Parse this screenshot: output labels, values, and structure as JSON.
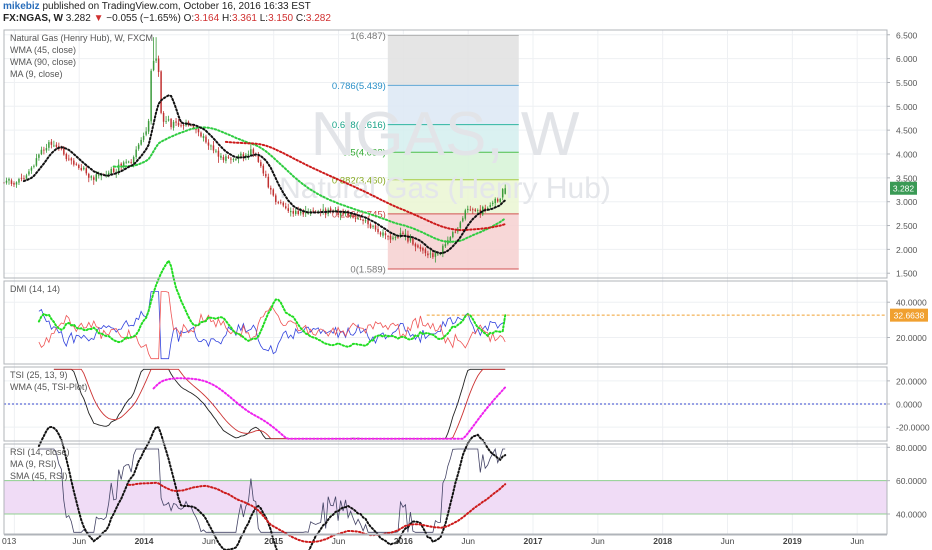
{
  "header": {
    "author": "mikebiz",
    "published": "published on TradingView.com, October 16, 2016 16:33 EST",
    "symbol_line": "FX:NGAS, W",
    "last": "3.282",
    "change": "−0.055 (−1.65%)",
    "open_label": "O:",
    "open": "3.164",
    "high_label": "H:",
    "high": "3.361",
    "low_label": "L:",
    "low": "3.150",
    "close_label": "C:",
    "close": "3.282"
  },
  "watermark": {
    "symbol": "NGAS, W",
    "name": "Natural Gas (Henry Hub)"
  },
  "colors": {
    "up": "#3a9a3a",
    "down": "#c03030",
    "grid": "#eef0f3",
    "border": "#b0b4ba",
    "wma45": "#2ecc40",
    "wma90": "#cc1a1a",
    "ma9": "#111111",
    "dmi_plus": "#3344dd",
    "dmi_minus": "#ee5555",
    "adx": "#22dd22",
    "tsi": "#222222",
    "tsi_signal": "#cc3333",
    "tsi_wma": "#ee22ee",
    "rsi": "#444466",
    "rsi_band": "#f0dcf6",
    "orange": "#f0a030"
  },
  "chart_data": [
    {
      "type": "candlestick",
      "panel": "price",
      "legend": [
        "Natural Gas (Henry Hub), W, FXCM",
        "WMA (45, close)",
        "WMA (90, close)",
        "MA (9, close)"
      ],
      "ylim": [
        1.4,
        6.6
      ],
      "y_ticks": [
        "1.500",
        "2.000",
        "2.500",
        "3.000",
        "3.500",
        "4.000",
        "4.500",
        "5.000",
        "5.500",
        "6.000",
        "6.500"
      ],
      "last_price_label": "3.282",
      "series_keys": [
        {
          "t": 2013.0,
          "c": 3.4
        },
        {
          "t": 2013.1,
          "c": 3.6
        },
        {
          "t": 2013.25,
          "c": 4.2
        },
        {
          "t": 2013.35,
          "c": 4.1
        },
        {
          "t": 2013.45,
          "c": 3.8
        },
        {
          "t": 2013.6,
          "c": 3.5
        },
        {
          "t": 2013.75,
          "c": 3.6
        },
        {
          "t": 2013.9,
          "c": 3.9
        },
        {
          "t": 2014.0,
          "c": 4.3
        },
        {
          "t": 2014.08,
          "c": 5.3
        },
        {
          "t": 2014.15,
          "c": 4.7
        },
        {
          "t": 2014.25,
          "c": 4.6
        },
        {
          "t": 2014.4,
          "c": 4.5
        },
        {
          "t": 2014.5,
          "c": 4.2
        },
        {
          "t": 2014.6,
          "c": 3.9
        },
        {
          "t": 2014.75,
          "c": 3.95
        },
        {
          "t": 2014.85,
          "c": 4.1
        },
        {
          "t": 2014.95,
          "c": 3.4
        },
        {
          "t": 2015.05,
          "c": 2.9
        },
        {
          "t": 2015.2,
          "c": 2.75
        },
        {
          "t": 2015.35,
          "c": 2.8
        },
        {
          "t": 2015.5,
          "c": 2.75
        },
        {
          "t": 2015.65,
          "c": 2.7
        },
        {
          "t": 2015.78,
          "c": 2.45
        },
        {
          "t": 2015.9,
          "c": 2.2
        },
        {
          "t": 2016.0,
          "c": 2.3
        },
        {
          "t": 2016.12,
          "c": 2.0
        },
        {
          "t": 2016.22,
          "c": 1.85
        },
        {
          "t": 2016.3,
          "c": 2.0
        },
        {
          "t": 2016.4,
          "c": 2.4
        },
        {
          "t": 2016.5,
          "c": 2.85
        },
        {
          "t": 2016.6,
          "c": 2.8
        },
        {
          "t": 2016.7,
          "c": 2.95
        },
        {
          "t": 2016.79,
          "c": 3.28
        }
      ],
      "fibonacci": [
        {
          "label": "1(6.487)",
          "value": 6.487
        },
        {
          "label": "0.786(5.439)",
          "value": 5.439
        },
        {
          "label": "0.618(4.616)",
          "value": 4.616
        },
        {
          "label": "0.5(4.038)",
          "value": 4.038
        },
        {
          "label": "0.382(3.460)",
          "value": 3.46
        },
        {
          "label": "0.236(2.745)",
          "value": 2.745
        },
        {
          "label": "0(1.589)",
          "value": 1.589
        }
      ]
    },
    {
      "type": "line",
      "panel": "dmi",
      "legend": [
        "DMI (14, 14)"
      ],
      "ylim": [
        5,
        52
      ],
      "y_ticks": [
        "20.0000",
        "40.0000"
      ],
      "last_label": "32.6638",
      "last_value": 32.66
    },
    {
      "type": "line",
      "panel": "tsi",
      "legend": [
        "TSI (25, 13, 9)",
        "WMA (45, TSI-Plot)"
      ],
      "ylim": [
        -32,
        32
      ],
      "y_ticks": [
        "20.0000",
        "0.0000",
        "-20.0000"
      ]
    },
    {
      "type": "line",
      "panel": "rsi",
      "legend": [
        "RSI (14, close)",
        "MA (9, RSI)",
        "SMA (45, RSI)"
      ],
      "ylim": [
        28,
        82
      ],
      "y_ticks": [
        "40.0000",
        "60.0000",
        "80.0000"
      ],
      "bands": [
        40,
        60
      ]
    }
  ],
  "x_axis": {
    "labels": [
      {
        "t": 2013.0,
        "text": "013"
      },
      {
        "t": 2013.5,
        "text": "Jun"
      },
      {
        "t": 2014.0,
        "text": "2014"
      },
      {
        "t": 2014.5,
        "text": "Jun"
      },
      {
        "t": 2015.0,
        "text": "2015"
      },
      {
        "t": 2015.5,
        "text": "Jun"
      },
      {
        "t": 2016.0,
        "text": "2016"
      },
      {
        "t": 2016.5,
        "text": "Jun"
      },
      {
        "t": 2017.0,
        "text": "2017"
      },
      {
        "t": 2017.5,
        "text": "Jun"
      },
      {
        "t": 2018.0,
        "text": "2018"
      },
      {
        "t": 2018.5,
        "text": "Jun"
      },
      {
        "t": 2019.0,
        "text": "2019"
      },
      {
        "t": 2019.5,
        "text": "Jun"
      }
    ]
  }
}
